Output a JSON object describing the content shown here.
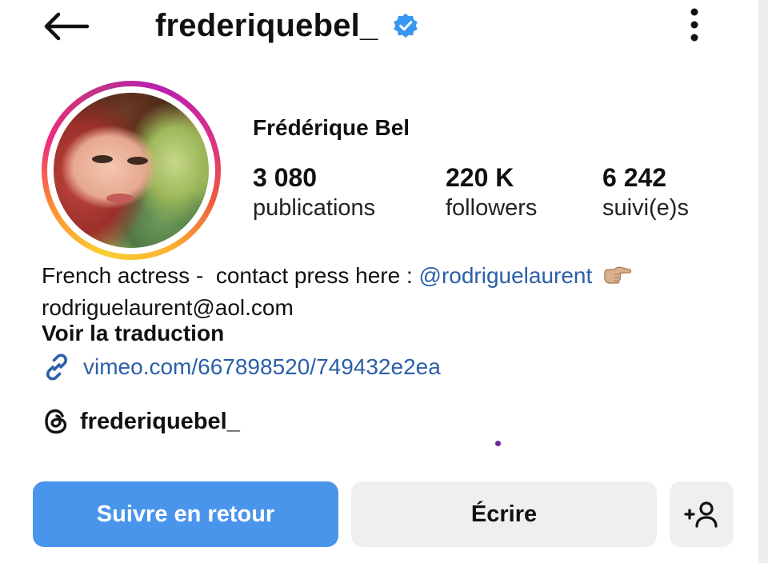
{
  "header": {
    "username": "frederiquebel_",
    "back_icon": "arrow-left-icon",
    "verified_icon": "verified-badge-icon",
    "more_icon": "more-vertical-icon"
  },
  "profile": {
    "display_name": "Frédérique Bel",
    "stats": [
      {
        "value": "3 080",
        "label": "publications"
      },
      {
        "value": "220 K",
        "label": "followers"
      },
      {
        "value": "6 242",
        "label": "suivi(e)s"
      }
    ]
  },
  "bio": {
    "line1_prefix": "French actress -  contact press here : ",
    "mention": "@rodriguelaurent",
    "emoji_icon": "pointing-hand-emoji",
    "line2": "rodriguelaurent@aol.com",
    "translate_label": "Voir la traduction",
    "link_icon": "link-icon",
    "link": "vimeo.com/667898520/749432e2ea",
    "threads_icon": "threads-icon",
    "threads_handle": "frederiquebel_"
  },
  "actions": {
    "follow_back": "Suivre en retour",
    "message": "Écrire",
    "add_user_icon": "add-user-icon"
  },
  "colors": {
    "accent_blue": "#4a95ec",
    "link_blue": "#2b5fa8",
    "button_gray": "#efefef",
    "verified_blue": "#3897f0"
  }
}
